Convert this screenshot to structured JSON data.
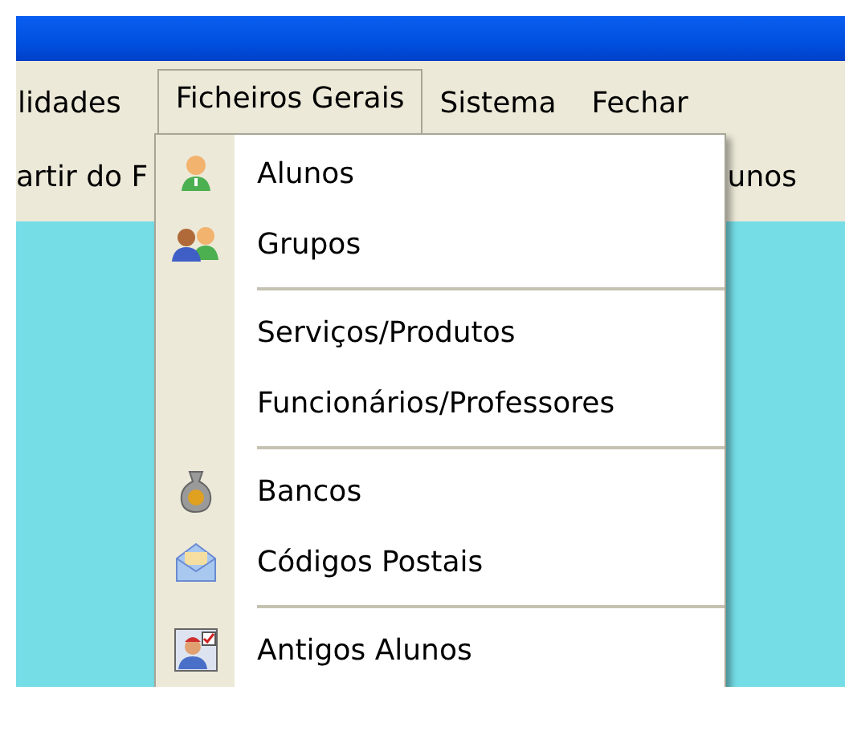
{
  "menubar": [
    {
      "label": "lidades",
      "selected": false
    },
    {
      "label": "Ficheiros Gerais",
      "selected": true
    },
    {
      "label": "Sistema",
      "selected": false
    },
    {
      "label": "Fechar",
      "selected": false
    }
  ],
  "toolbar": {
    "left_text": "artir do F",
    "right_text": "unos"
  },
  "dropdown": [
    {
      "kind": "item",
      "label": "Alunos"
    },
    {
      "kind": "item",
      "label": "Grupos"
    },
    {
      "kind": "separator"
    },
    {
      "kind": "item",
      "label": "Serviços/Produtos"
    },
    {
      "kind": "item",
      "label": "Funcionários/Professores"
    },
    {
      "kind": "separator"
    },
    {
      "kind": "item",
      "label": "Bancos"
    },
    {
      "kind": "item",
      "label": "Códigos Postais"
    },
    {
      "kind": "separator"
    },
    {
      "kind": "item",
      "label": "Antigos Alunos"
    }
  ]
}
